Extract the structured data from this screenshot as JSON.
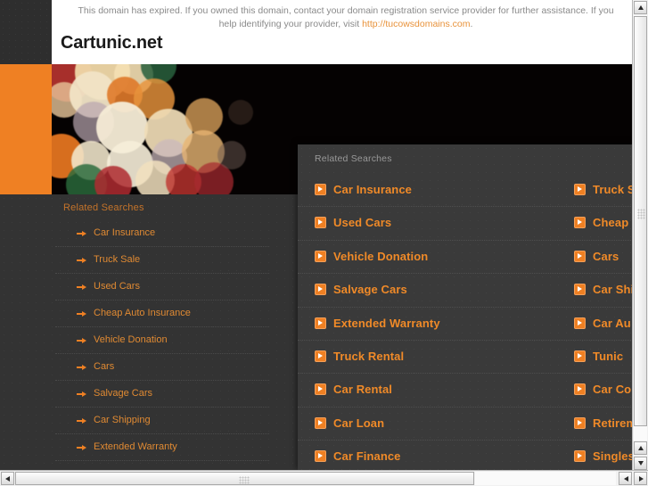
{
  "header": {
    "notice_line1": "This domain has expired. If you owned this domain, contact your domain registration service provider for further assistance. If you",
    "notice_line2_pre": "help identifying your provider, visit ",
    "notice_link": "http://tucowsdomains.com",
    "notice_line2_post": ".",
    "site_title": "Cartunic.net"
  },
  "colors": {
    "accent_orange": "#ef8023",
    "link_orange": "#e08a33",
    "page_dark": "#333333",
    "panel_dark": "#3a3a3a",
    "notice_gray": "#8a8a8a"
  },
  "search": {
    "value": "",
    "placeholder": "",
    "icon": "search-icon"
  },
  "sidebar": {
    "heading": "Related Searches",
    "items": [
      {
        "label": "Car Insurance"
      },
      {
        "label": "Truck Sale"
      },
      {
        "label": "Used Cars"
      },
      {
        "label": "Cheap Auto Insurance"
      },
      {
        "label": "Vehicle Donation"
      },
      {
        "label": "Cars"
      },
      {
        "label": "Salvage Cars"
      },
      {
        "label": "Car Shipping"
      },
      {
        "label": "Extended Warranty"
      }
    ]
  },
  "overlay": {
    "heading": "Related Searches",
    "rows": [
      {
        "left": "Car Insurance",
        "right": "Truck S"
      },
      {
        "left": "Used Cars",
        "right": "Cheap"
      },
      {
        "left": "Vehicle Donation",
        "right": "Cars"
      },
      {
        "left": "Salvage Cars",
        "right": "Car Shi"
      },
      {
        "left": "Extended Warranty",
        "right": "Car Au"
      },
      {
        "left": "Truck Rental",
        "right": "Tunic"
      },
      {
        "left": "Car Rental",
        "right": "Car Co"
      },
      {
        "left": "Car Loan",
        "right": "Retirem"
      },
      {
        "left": "Car Finance",
        "right": "Singles"
      }
    ]
  },
  "scrollbars": {
    "vertical": {
      "up": "▲",
      "down": "▼"
    },
    "horizontal": {
      "left": "◀",
      "right": "▶"
    }
  }
}
